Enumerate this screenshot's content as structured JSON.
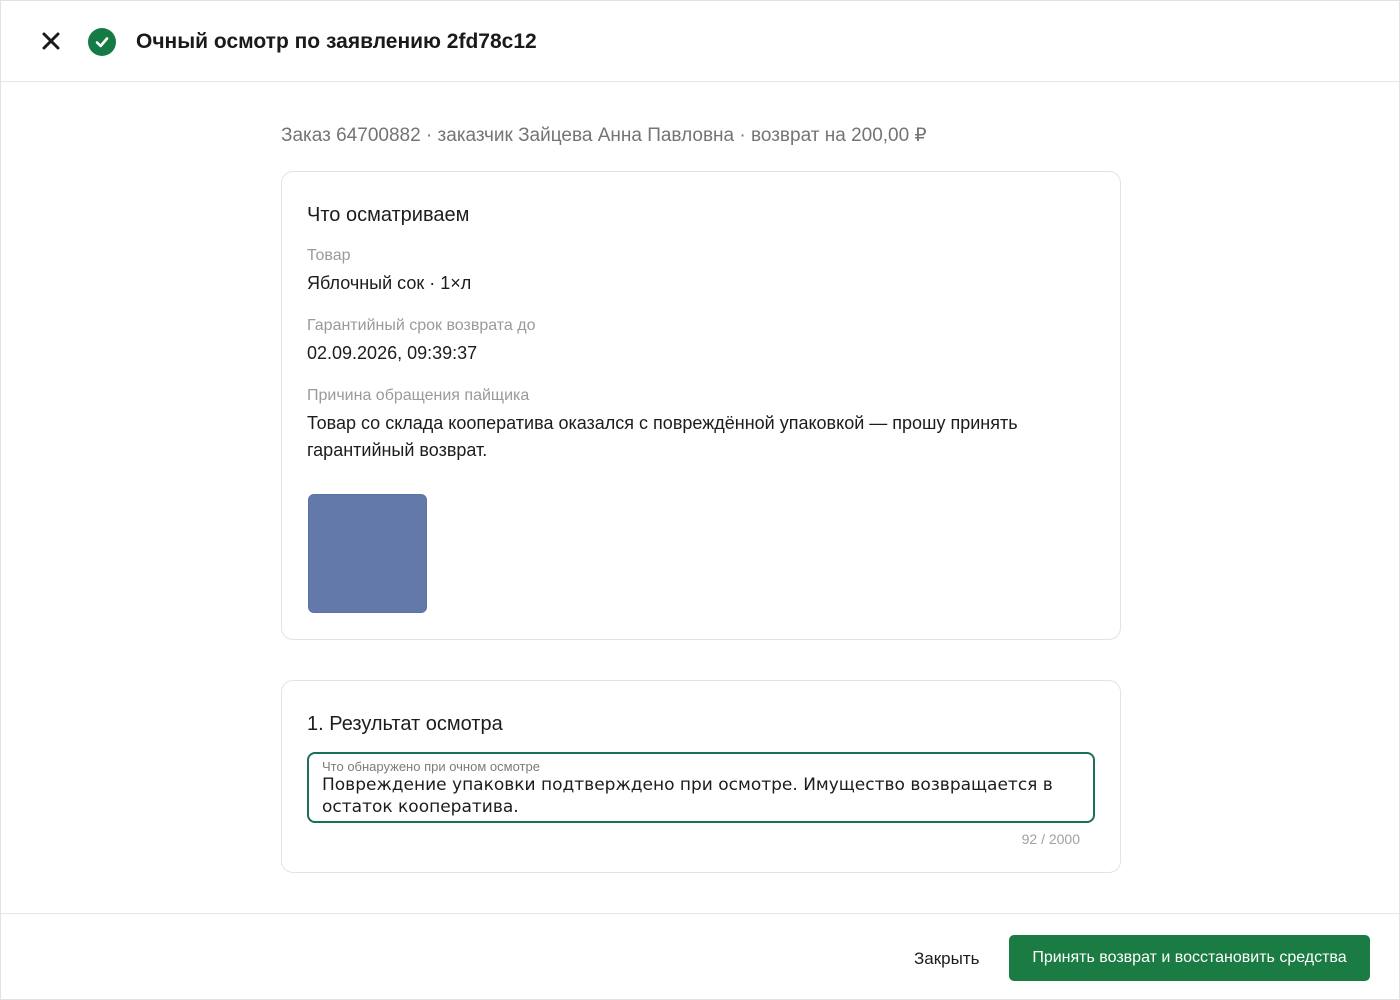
{
  "header": {
    "title": "Очный осмотр по заявлению 2fd78c12",
    "close_icon": "close-icon",
    "status_icon": "check-circle-icon",
    "accent_color": "#167a45"
  },
  "summary": {
    "line": "Заказ 64700882 · заказчик Зайцева Анна Павловна · возврат на 200,00 ₽"
  },
  "inspect_card": {
    "title": "Что осматриваем",
    "fields": [
      {
        "label": "Товар",
        "value": "Яблочный сок · 1×л"
      },
      {
        "label": "Гарантийный срок возврата до",
        "value": "02.09.2026, 09:39:37"
      },
      {
        "label": "Причина обращения пайщика",
        "value": "Товар со склада кооператива оказался с повреждённой упаковкой — прошу принять гарантийный возврат."
      }
    ],
    "photo_color": "#6379a9"
  },
  "result_card": {
    "title": "1. Результат осмотра",
    "textarea_label": "Что обнаружено при очном осмотре",
    "textarea_value": "Повреждение упаковки подтверждено при осмотре. Имущество возвращается в остаток кооператива.",
    "counter": "92 / 2000"
  },
  "footer": {
    "close_label": "Закрыть",
    "accept_label": "Принять возврат и восстановить средства",
    "accept_color": "#1a7b43"
  }
}
